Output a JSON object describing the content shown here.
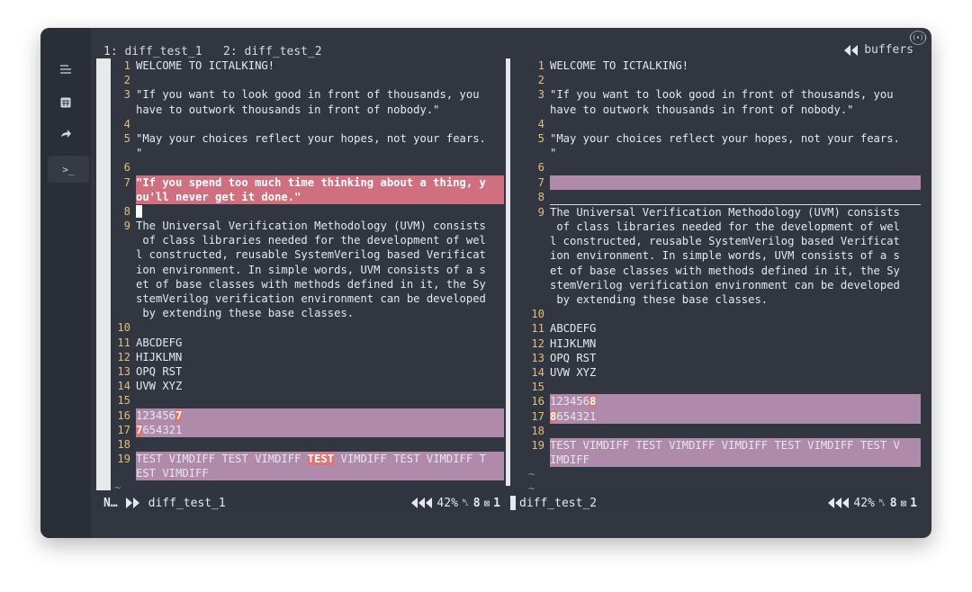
{
  "window": {
    "traffic_lights": {
      "close": "#fe5f57",
      "minimize": "#febc2e",
      "maximize": "#28c840"
    },
    "broadcast_icon": "broadcast-icon"
  },
  "activity_bar": {
    "items": [
      {
        "icon": "explorer-icon",
        "glyph": "☰"
      },
      {
        "icon": "calculator-icon",
        "glyph": "▦"
      },
      {
        "icon": "forward-arrow-icon",
        "glyph": "➜"
      },
      {
        "icon": "terminal-icon",
        "glyph": ">_"
      }
    ]
  },
  "tabline": {
    "tabs": "1: diff_test_1   2: diff_test_2",
    "buffers_label": "buffers"
  },
  "left_pane": {
    "lines": [
      {
        "n": "1",
        "t": "WELCOME TO ICTALKING!"
      },
      {
        "n": "2",
        "t": ""
      },
      {
        "n": "3",
        "t": "\"If you want to look good in front of thousands, you"
      },
      {
        "n": "",
        "t": "have to outwork thousands in front of nobody.\""
      },
      {
        "n": "4",
        "t": ""
      },
      {
        "n": "5",
        "t": "\"May your choices reflect your hopes, not your fears."
      },
      {
        "n": "",
        "t": "\""
      },
      {
        "n": "6",
        "t": ""
      },
      {
        "n": "7",
        "t": "\"If you spend too much time thinking about a thing, y"
      },
      {
        "n": "",
        "t": "ou'll never get it done.\""
      },
      {
        "n": "8",
        "t": ""
      },
      {
        "n": "9",
        "t": "The Universal Verification Methodology (UVM) consists"
      },
      {
        "n": "",
        "t": " of class libraries needed for the development of wel"
      },
      {
        "n": "",
        "t": "l constructed, reusable SystemVerilog based Verificat"
      },
      {
        "n": "",
        "t": "ion environment. In simple words, UVM consists of a s"
      },
      {
        "n": "",
        "t": "et of base classes with methods defined in it, the Sy"
      },
      {
        "n": "",
        "t": "stemVerilog verification environment can be developed"
      },
      {
        "n": "",
        "t": " by extending these base classes."
      },
      {
        "n": "10",
        "t": ""
      },
      {
        "n": "11",
        "t": "ABCDEFG"
      },
      {
        "n": "12",
        "t": "HIJKLMN"
      },
      {
        "n": "13",
        "t": "OPQ RST"
      },
      {
        "n": "14",
        "t": "UVW XYZ"
      },
      {
        "n": "15",
        "t": ""
      },
      {
        "n": "16",
        "t": "123456",
        "c": "7"
      },
      {
        "n": "17",
        "c": "7",
        "t": "654321"
      },
      {
        "n": "18",
        "t": ""
      },
      {
        "n": "19",
        "a": "TEST VIMDIFF TEST VIMDIFF ",
        "c": "TEST",
        "t": " VIMDIFF TEST VIMDIFF T"
      },
      {
        "n": "",
        "t": "EST VIMDIFF"
      },
      {
        "n": "~",
        "t": ""
      }
    ]
  },
  "right_pane": {
    "lines": [
      {
        "n": "1",
        "t": "WELCOME TO ICTALKING!"
      },
      {
        "n": "2",
        "t": ""
      },
      {
        "n": "3",
        "t": "\"If you want to look good in front of thousands, you"
      },
      {
        "n": "",
        "t": "have to outwork thousands in front of nobody.\""
      },
      {
        "n": "4",
        "t": ""
      },
      {
        "n": "5",
        "t": "\"May your choices reflect your hopes, not your fears."
      },
      {
        "n": "",
        "t": "\""
      },
      {
        "n": "6",
        "t": ""
      },
      {
        "n": "7",
        "t": ""
      },
      {
        "n": "8",
        "t": ""
      },
      {
        "n": "9",
        "t": "The Universal Verification Methodology (UVM) consists"
      },
      {
        "n": "",
        "t": " of class libraries needed for the development of wel"
      },
      {
        "n": "",
        "t": "l constructed, reusable SystemVerilog based Verificat"
      },
      {
        "n": "",
        "t": "ion environment. In simple words, UVM consists of a s"
      },
      {
        "n": "",
        "t": "et of base classes with methods defined in it, the Sy"
      },
      {
        "n": "",
        "t": "stemVerilog verification environment can be developed"
      },
      {
        "n": "",
        "t": " by extending these base classes."
      },
      {
        "n": "10",
        "t": ""
      },
      {
        "n": "11",
        "t": "ABCDEFG"
      },
      {
        "n": "12",
        "t": "HIJKLMN"
      },
      {
        "n": "13",
        "t": "OPQ RST"
      },
      {
        "n": "14",
        "t": "UVW XYZ"
      },
      {
        "n": "15",
        "t": ""
      },
      {
        "n": "16",
        "t": "123456",
        "c": "8"
      },
      {
        "n": "17",
        "c": "8",
        "t": "654321"
      },
      {
        "n": "18",
        "t": ""
      },
      {
        "n": "19",
        "t": "TEST VIMDIFF TEST VIMDIFF VIMDIFF TEST VIMDIFF TEST V"
      },
      {
        "n": "",
        "t": "IMDIFF"
      },
      {
        "n": "~",
        "t": ""
      },
      {
        "n": "~",
        "t": ""
      }
    ]
  },
  "status_left": {
    "mode": "N…",
    "filename": "diff_test_1",
    "percent": "42%",
    "line_label": "8",
    "col_label": "1"
  },
  "status_right": {
    "filename": "diff_test_2",
    "percent": "42%",
    "line_label": "8",
    "col_label": "1"
  },
  "colors": {
    "background": "#313641",
    "changed_line": "#b08aab",
    "deleted_line": "#cf6f80",
    "changed_text": "#e07272",
    "line_number": "#e3bd7f"
  }
}
